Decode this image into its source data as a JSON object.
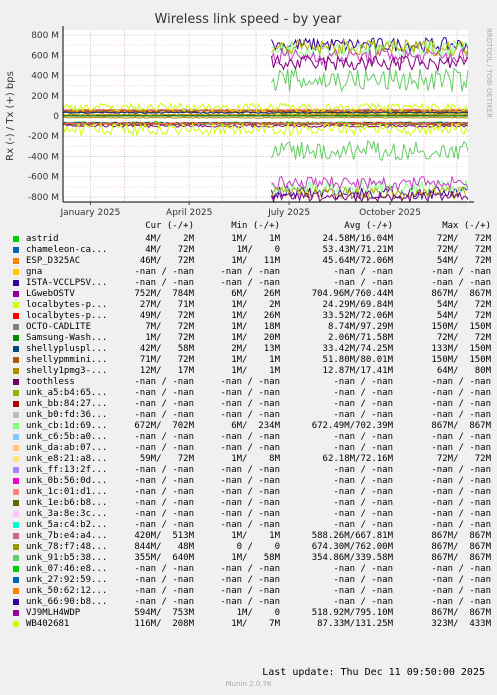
{
  "chart_data": {
    "type": "line",
    "title": "Wireless link speed - by year",
    "ylabel": "Rx (-) / Tx (+) bps",
    "ylim": [
      -850,
      850
    ],
    "yticks": [
      "800 M",
      "600 M",
      "400 M",
      "200 M",
      "0",
      "-200 M",
      "-400 M",
      "-600 M",
      "-800 M"
    ],
    "ytick_values": [
      800,
      600,
      400,
      200,
      0,
      -200,
      -400,
      -600,
      -800
    ],
    "xticks": [
      "January 2025",
      "April 2025",
      "July 2025",
      "October 2025"
    ],
    "xlim": [
      "2024-12-07",
      "2025-12-11"
    ],
    "xtick_dates": [
      "2025-01-01",
      "2025-04-01",
      "2025-07-01",
      "2025-10-01"
    ],
    "grid": true,
    "watermark": "RRDTOOL / TOBI OETIKER",
    "series": [
      {
        "name": "astrid",
        "color": "#00cc00",
        "start": "2024-12-07",
        "end": "2025-12-11",
        "tx": 4,
        "rx": 72,
        "tx_jitter": 8,
        "rx_jitter": 15
      },
      {
        "name": "chameleon-ca...",
        "color": "#0066b3",
        "start": "2024-12-07",
        "end": "2025-12-11",
        "tx": 53,
        "rx": 71,
        "tx_jitter": 10,
        "rx_jitter": 10
      },
      {
        "name": "ESP_D325AC",
        "color": "#ff8000",
        "start": "2024-12-07",
        "end": "2025-12-11",
        "tx": 45,
        "rx": 72,
        "tx_jitter": 8,
        "rx_jitter": 6
      },
      {
        "name": "LGwebOSTV",
        "color": "#330099",
        "start": "2025-06-15",
        "end": "2025-12-11",
        "tx": 705,
        "rx": 760,
        "tx_jitter": 70,
        "rx_jitter": 60
      },
      {
        "name": "localbytes-p...",
        "color": "#ccff00",
        "start": "2025-06-15",
        "end": "2025-12-11",
        "tx": 24,
        "rx": 70,
        "tx_jitter": 6,
        "rx_jitter": 8
      },
      {
        "name": "localbytes-p...",
        "color": "#aa0000",
        "start": "2024-12-07",
        "end": "2025-12-11",
        "tx": 34,
        "rx": 72,
        "tx_jitter": 8,
        "rx_jitter": 10
      },
      {
        "name": "OCTO-CADLITE",
        "color": "#800080",
        "start": "2024-12-07",
        "end": "2025-12-11",
        "tx": 9,
        "rx": 97,
        "tx_jitter": 4,
        "rx_jitter": 15
      },
      {
        "name": "Samsung-Wash...",
        "color": "#008f00",
        "start": "2024-12-07",
        "end": "2025-12-11",
        "tx": 2,
        "rx": 72,
        "tx_jitter": 3,
        "rx_jitter": 8
      },
      {
        "name": "shellypluspl...",
        "color": "#00487d",
        "start": "2024-12-07",
        "end": "2025-12-11",
        "tx": 33,
        "rx": 74,
        "tx_jitter": 8,
        "rx_jitter": 10
      },
      {
        "name": "shellypmmini...",
        "color": "#b35a00",
        "start": "2024-12-07",
        "end": "2025-12-11",
        "tx": 52,
        "rx": 80,
        "tx_jitter": 8,
        "rx_jitter": 10
      },
      {
        "name": "shelly1pmg3-...",
        "color": "#b38f00",
        "start": "2024-12-07",
        "end": "2025-12-11",
        "tx": 13,
        "rx": 17,
        "tx_jitter": 4,
        "rx_jitter": 5
      },
      {
        "name": "unk_cb:1d:69...",
        "color": "#8fff8f",
        "start": "2025-06-15",
        "end": "2025-12-11",
        "tx": 672,
        "rx": 702,
        "tx_jitter": 80,
        "rx_jitter": 70
      },
      {
        "name": "unk_e8:21:a8...",
        "color": "#ff6666",
        "start": "2024-12-07",
        "end": "2025-12-11",
        "tx": 62,
        "rx": 72,
        "tx_jitter": 6,
        "rx_jitter": 6
      },
      {
        "name": "unk_7b:e4:a4...",
        "color": "#c33cc3",
        "start": "2025-06-15",
        "end": "2025-12-11",
        "tx": 588,
        "rx": 668,
        "tx_jitter": 80,
        "rx_jitter": 70
      },
      {
        "name": "unk_78:f7:48...",
        "color": "#b3b300",
        "start": "2025-06-15",
        "end": "2025-12-11",
        "tx": 674,
        "rx": 762,
        "tx_jitter": 80,
        "rx_jitter": 60
      },
      {
        "name": "unk_91:b5:38...",
        "color": "#66cc66",
        "start": "2025-06-15",
        "end": "2025-12-11",
        "tx": 355,
        "rx": 340,
        "tx_jitter": 120,
        "rx_jitter": 100
      },
      {
        "name": "VJ9MLH4WDP",
        "color": "#800080",
        "start": "2025-06-15",
        "end": "2025-12-11",
        "tx": 519,
        "rx": 795,
        "tx_jitter": 80,
        "rx_jitter": 50
      },
      {
        "name": "WB402681",
        "color": "#ccff00",
        "start": "2024-12-07",
        "end": "2025-12-11",
        "tx": 87,
        "rx": 131,
        "tx_jitter": 40,
        "rx_jitter": 60
      }
    ]
  },
  "legend": {
    "headers": {
      "cur": "Cur (-/+)",
      "min": "Min (-/+)",
      "avg": "Avg (-/+)",
      "max": "Max (-/+)"
    },
    "rows": [
      {
        "name": "astrid",
        "color": "#00cc00",
        "cur": "4M/    2M",
        "min": "1M/    1M",
        "avg": "24.58M/16.04M",
        "max": "72M/   72M"
      },
      {
        "name": "chameleon-ca...",
        "color": "#0066b3",
        "cur": "4M/   72M",
        "min": "1M/    0",
        "avg": "53.43M/71.21M",
        "max": "72M/   72M"
      },
      {
        "name": "ESP_D325AC",
        "color": "#ff8000",
        "cur": "46M/   72M",
        "min": "1M/   11M",
        "avg": "45.64M/72.06M",
        "max": "54M/   72M"
      },
      {
        "name": "gna",
        "color": "#ffcc00",
        "cur": "-nan / -nan",
        "min": "-nan / -nan",
        "avg": "-nan / -nan",
        "max": "-nan / -nan"
      },
      {
        "name": "ISTA-VCCLPSV...",
        "color": "#330099",
        "cur": "-nan / -nan",
        "min": "-nan / -nan",
        "avg": "-nan / -nan",
        "max": "-nan / -nan"
      },
      {
        "name": "LGwebOSTV",
        "color": "#990099",
        "cur": "752M/  784M",
        "min": "6M/   26M",
        "avg": "704.96M/760.44M",
        "max": "867M/  867M"
      },
      {
        "name": "localbytes-p...",
        "color": "#ccff00",
        "cur": "27M/   71M",
        "min": "1M/    2M",
        "avg": "24.29M/69.84M",
        "max": "54M/   72M"
      },
      {
        "name": "localbytes-p...",
        "color": "#ff0000",
        "cur": "49M/   72M",
        "min": "1M/   26M",
        "avg": "33.52M/72.06M",
        "max": "54M/   72M"
      },
      {
        "name": "OCTO-CADLITE",
        "color": "#808080",
        "cur": "7M/   72M",
        "min": "1M/   18M",
        "avg": "8.74M/97.29M",
        "max": "150M/  150M"
      },
      {
        "name": "Samsung-Wash...",
        "color": "#008f00",
        "cur": "1M/   72M",
        "min": "1M/   20M",
        "avg": "2.06M/71.58M",
        "max": "72M/   72M"
      },
      {
        "name": "shellypluspl...",
        "color": "#00487d",
        "cur": "42M/   58M",
        "min": "2M/   13M",
        "avg": "33.42M/74.25M",
        "max": "133M/  150M"
      },
      {
        "name": "shellypmmini...",
        "color": "#b35a00",
        "cur": "71M/   72M",
        "min": "1M/    1M",
        "avg": "51.80M/80.01M",
        "max": "150M/  150M"
      },
      {
        "name": "shelly1pmg3-...",
        "color": "#b38f00",
        "cur": "12M/   17M",
        "min": "1M/    1M",
        "avg": "12.87M/17.41M",
        "max": "64M/   80M"
      },
      {
        "name": "toothless",
        "color": "#6b006b",
        "cur": "-nan / -nan",
        "min": "-nan / -nan",
        "avg": "-nan / -nan",
        "max": "-nan / -nan"
      },
      {
        "name": "unk_a5:b4:65...",
        "color": "#8fb300",
        "cur": "-nan / -nan",
        "min": "-nan / -nan",
        "avg": "-nan / -nan",
        "max": "-nan / -nan"
      },
      {
        "name": "unk_bb:84:27...",
        "color": "#b30000",
        "cur": "-nan / -nan",
        "min": "-nan / -nan",
        "avg": "-nan / -nan",
        "max": "-nan / -nan"
      },
      {
        "name": "unk_b0:fd:36...",
        "color": "#bebebe",
        "cur": "-nan / -nan",
        "min": "-nan / -nan",
        "avg": "-nan / -nan",
        "max": "-nan / -nan"
      },
      {
        "name": "unk_cb:1d:69...",
        "color": "#80ff80",
        "cur": "672M/  702M",
        "min": "6M/  234M",
        "avg": "672.49M/702.39M",
        "max": "867M/  867M"
      },
      {
        "name": "unk_c6:5b:a0...",
        "color": "#80c9ff",
        "cur": "-nan / -nan",
        "min": "-nan / -nan",
        "avg": "-nan / -nan",
        "max": "-nan / -nan"
      },
      {
        "name": "unk_da:ab:07...",
        "color": "#ffc080",
        "cur": "-nan / -nan",
        "min": "-nan / -nan",
        "avg": "-nan / -nan",
        "max": "-nan / -nan"
      },
      {
        "name": "unk_e8:21:a8...",
        "color": "#ffe680",
        "cur": "59M/   72M",
        "min": "1M/    8M",
        "avg": "62.18M/72.16M",
        "max": "72M/   72M"
      },
      {
        "name": "unk_ff:13:2f...",
        "color": "#aa80ff",
        "cur": "-nan / -nan",
        "min": "-nan / -nan",
        "avg": "-nan / -nan",
        "max": "-nan / -nan"
      },
      {
        "name": "unk_0b:56:0d...",
        "color": "#ee00cc",
        "cur": "-nan / -nan",
        "min": "-nan / -nan",
        "avg": "-nan / -nan",
        "max": "-nan / -nan"
      },
      {
        "name": "unk_1c:01:d1...",
        "color": "#ff8080",
        "cur": "-nan / -nan",
        "min": "-nan / -nan",
        "avg": "-nan / -nan",
        "max": "-nan / -nan"
      },
      {
        "name": "unk_1e:b6:b8...",
        "color": "#666600",
        "cur": "-nan / -nan",
        "min": "-nan / -nan",
        "avg": "-nan / -nan",
        "max": "-nan / -nan"
      },
      {
        "name": "unk_3a:8e:3c...",
        "color": "#ffbfff",
        "cur": "-nan / -nan",
        "min": "-nan / -nan",
        "avg": "-nan / -nan",
        "max": "-nan / -nan"
      },
      {
        "name": "unk_5a:c4:b2...",
        "color": "#00ffcc",
        "cur": "-nan / -nan",
        "min": "-nan / -nan",
        "avg": "-nan / -nan",
        "max": "-nan / -nan"
      },
      {
        "name": "unk_7b:e4:a4...",
        "color": "#cc6699",
        "cur": "420M/  513M",
        "min": "1M/    1M",
        "avg": "588.26M/667.81M",
        "max": "867M/  867M"
      },
      {
        "name": "unk_78:f7:48...",
        "color": "#999900",
        "cur": "844M/   48M",
        "min": "0 /    0",
        "avg": "674.30M/762.00M",
        "max": "867M/  867M"
      },
      {
        "name": "unk_91:b5:38...",
        "color": "#66cc66",
        "cur": "355M/  640M",
        "min": "1M/   58M",
        "avg": "354.86M/339.58M",
        "max": "867M/  867M"
      },
      {
        "name": "unk_07:46:e8...",
        "color": "#00cc00",
        "cur": "-nan / -nan",
        "min": "-nan / -nan",
        "avg": "-nan / -nan",
        "max": "-nan / -nan"
      },
      {
        "name": "unk_27:92:59...",
        "color": "#0066b3",
        "cur": "-nan / -nan",
        "min": "-nan / -nan",
        "avg": "-nan / -nan",
        "max": "-nan / -nan"
      },
      {
        "name": "unk_50:62:12...",
        "color": "#ff8000",
        "cur": "-nan / -nan",
        "min": "-nan / -nan",
        "avg": "-nan / -nan",
        "max": "-nan / -nan"
      },
      {
        "name": "unk_66:90:b8...",
        "color": "#330099",
        "cur": "-nan / -nan",
        "min": "-nan / -nan",
        "avg": "-nan / -nan",
        "max": "-nan / -nan"
      },
      {
        "name": "VJ9MLH4WDP",
        "color": "#990099",
        "cur": "594M/  753M",
        "min": "1M/    0",
        "avg": "518.92M/795.10M",
        "max": "867M/  867M"
      },
      {
        "name": "WB402681",
        "color": "#ccff00",
        "cur": "116M/  208M",
        "min": "1M/    7M",
        "avg": "87.33M/131.25M",
        "max": "323M/  433M"
      }
    ]
  },
  "footer": {
    "last_update": "Last update: Thu Dec 11 09:50:00 2025",
    "version": "Munin 2.0.76"
  }
}
